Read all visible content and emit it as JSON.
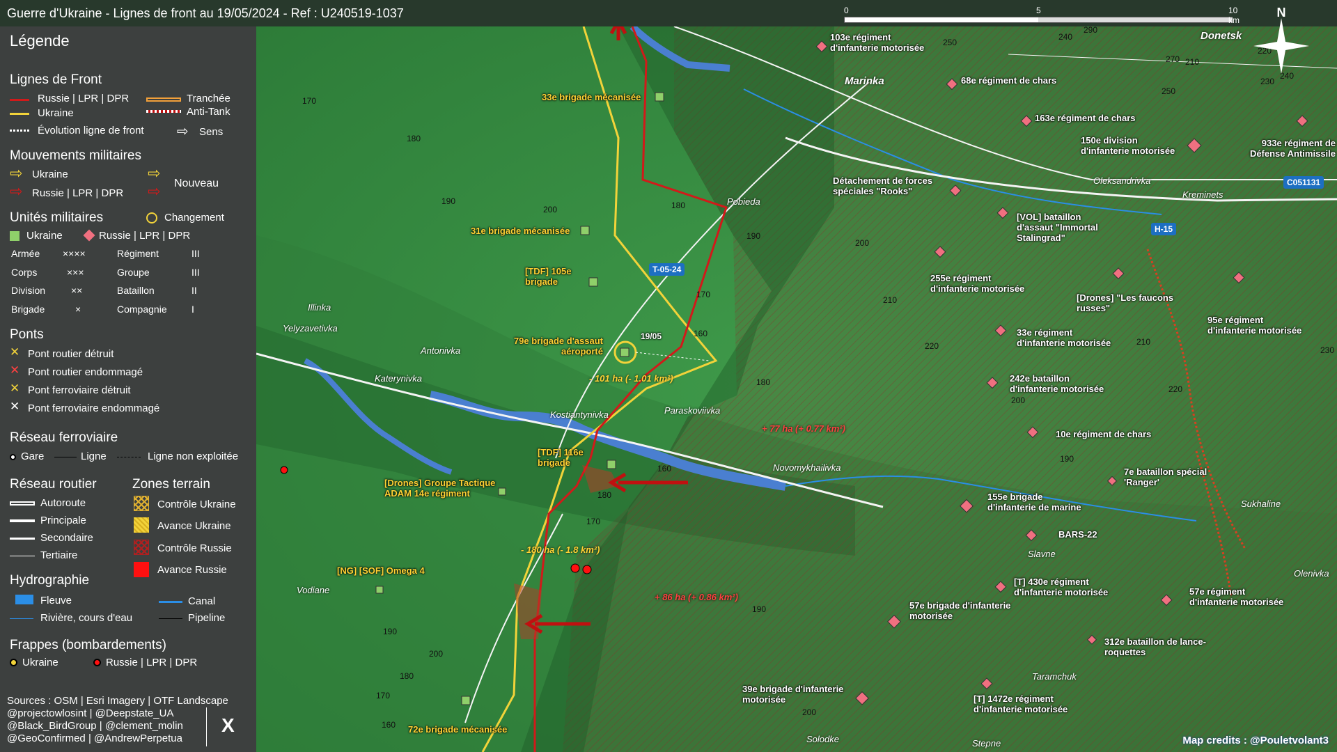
{
  "title": "Guerre d'Ukraine - Lignes de front au 19/05/2024 - Ref : U240519-1037",
  "legend": {
    "title": "Légende",
    "front": {
      "header": "Lignes de Front",
      "russie": "Russie | LPR | DPR",
      "ukraine": "Ukraine",
      "tranchee": "Tranchée",
      "antitank": "Anti-Tank",
      "evolution": "Évolution ligne de front",
      "sens": "Sens"
    },
    "mouvements": {
      "header": "Mouvements militaires",
      "ukraine": "Ukraine",
      "russie": "Russie | LPR | DPR",
      "nouveau": "Nouveau"
    },
    "unites": {
      "header": "Unités militaires",
      "changement": "Changement",
      "ukraine": "Ukraine",
      "russie": "Russie | LPR | DPR",
      "rows": [
        {
          "a": "Armée",
          "as": "××××",
          "b": "Régiment",
          "bs": "III"
        },
        {
          "a": "Corps",
          "as": "×××",
          "b": "Groupe",
          "bs": "III"
        },
        {
          "a": "Division",
          "as": "××",
          "b": "Bataillon",
          "bs": "II"
        },
        {
          "a": "Brigade",
          "as": "×",
          "b": "Compagnie",
          "bs": "I"
        }
      ]
    },
    "ponts": {
      "header": "Ponts",
      "items": [
        "Pont routier détruit",
        "Pont routier endommagé",
        "Pont ferroviaire détruit",
        "Pont ferroviaire endommagé"
      ]
    },
    "ferroviaire": {
      "header": "Réseau ferroviaire",
      "gare": "Gare",
      "ligne": "Ligne",
      "nonexploitee": "Ligne non exploitée"
    },
    "routier": {
      "header": "Réseau routier",
      "items": [
        "Autoroute",
        "Principale",
        "Secondaire",
        "Tertiaire"
      ]
    },
    "zones": {
      "header": "Zones terrain",
      "items": [
        "Contrôle Ukraine",
        "Avance Ukraine",
        "Contrôle Russie",
        "Avance Russie"
      ]
    },
    "hydro": {
      "header": "Hydrographie",
      "fleuve": "Fleuve",
      "canal": "Canal",
      "riviere": "Rivière, cours d'eau",
      "pipeline": "Pipeline"
    },
    "frappes": {
      "header": "Frappes (bombardements)",
      "ukraine": "Ukraine",
      "russie": "Russie | LPR | DPR"
    },
    "sources": [
      "Sources : OSM | Esri Imagery | OTF Landscape",
      "@projectowlosint | @Deepstate_UA",
      "@Black_BirdGroup | @clement_molin",
      "@GeoConfirmed | @AndrewPerpetua"
    ],
    "x_logo": "X"
  },
  "scale": {
    "l0": "0",
    "l5": "5",
    "l10": "10 km"
  },
  "north": "N",
  "credit": "Map credits : @Pouletvolant3",
  "roads": [
    "T-05-24",
    "H-15",
    "C051131"
  ],
  "date_marker": "19/05",
  "areas": [
    {
      "text": "- 101 ha (- 1.01 km²)",
      "side": "u"
    },
    {
      "text": "+ 77 ha (+ 0.77 km²)",
      "side": "r"
    },
    {
      "text": "- 180 ha (- 1.8 km²)",
      "side": "u"
    },
    {
      "text": "+ 86 ha (+ 0.86 km²)",
      "side": "r"
    }
  ],
  "towns": [
    "Marinka",
    "Donetsk",
    "Pobieda",
    "Oleksandrivka",
    "Kreminets",
    "Illinka",
    "Yelyzavetivka",
    "Antonivka",
    "Katerynivka",
    "Kostiantynivka",
    "Paraskoviivka",
    "Novomykhailivka",
    "Slavne",
    "Sukhaline",
    "Olenivka",
    "Vodiane",
    "Taramchuk",
    "Solodke",
    "Stepne"
  ],
  "units_ukr": [
    "33e brigade mécanisée",
    "31e brigade mécanisée",
    "[TDF] 105e brigade",
    "79e brigade d'assaut aéroporté",
    "[TDF] 116e brigade",
    "[Drones] Groupe Tactique ADAM 14e régiment",
    "[NG] [SOF] Omega 4",
    "72e brigade mécanisée"
  ],
  "units_rus": [
    "103e régiment d'infanterie motorisée",
    "68e régiment de chars",
    "163e régiment de chars",
    "150e division d'infanterie motorisée",
    "933e régiment de Défense Antimissile",
    "Détachement de forces spéciales \"Rooks\"",
    "[VOL] bataillon d'assaut \"Immortal Stalingrad\"",
    "255e régiment d'infanterie motorisée",
    "[Drones] \"Les faucons russes\"",
    "95e régiment d'infanterie motorisée",
    "33e régiment d'infanterie motorisée",
    "242e bataillon d'infanterie motorisée",
    "10e régiment de chars",
    "7e bataillon spécial 'Ranger'",
    "155e brigade d'infanterie de marine",
    "BARS-22",
    "[T] 430e régiment d'infanterie motorisée",
    "57e régiment d'infanterie motorisée",
    "57e brigade d'infanterie motorisée",
    "312e bataillon de lance-roquettes",
    "[T] 1472e régiment d'infanterie motorisée",
    "39e brigade d'infanterie motorisée"
  ],
  "elevations": [
    "170",
    "180",
    "190",
    "200",
    "180",
    "190",
    "170",
    "160",
    "180",
    "200",
    "210",
    "220",
    "200",
    "210",
    "220",
    "230",
    "190",
    "180",
    "170",
    "160",
    "200",
    "190",
    "180",
    "170",
    "160",
    "190",
    "200",
    "240",
    "290",
    "250",
    "270",
    "210",
    "250",
    "230",
    "240",
    "220"
  ],
  "colors": {
    "russia": "#d11a1a",
    "ukraine": "#f2d33a",
    "water": "#4a7fd0",
    "panel": "#3d403f"
  }
}
